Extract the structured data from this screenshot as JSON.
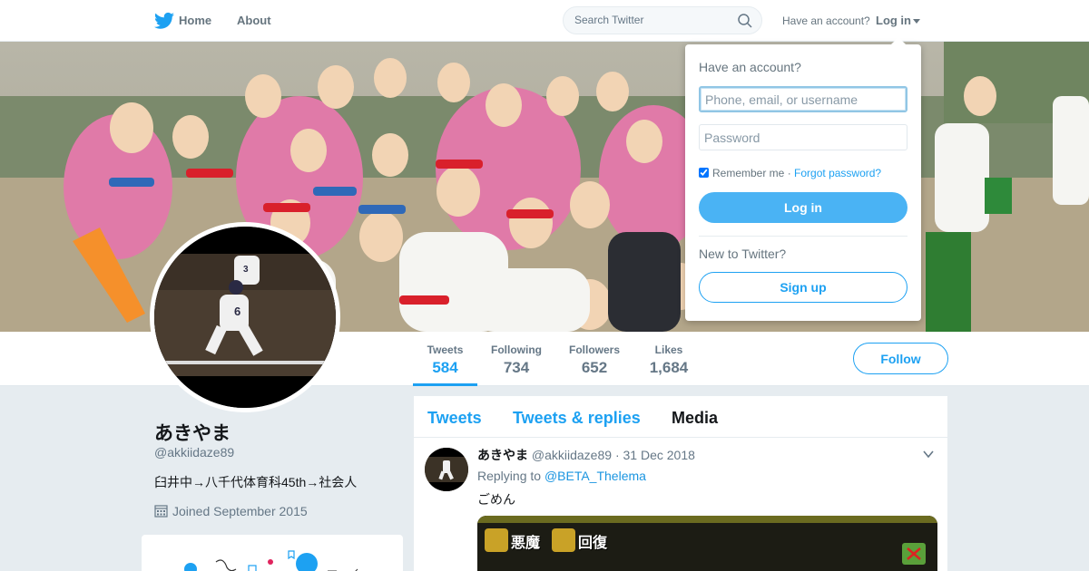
{
  "nav": {
    "home_label": "Home",
    "about_label": "About",
    "search_placeholder": "Search Twitter",
    "have_account": "Have an account?",
    "login_label": "Log in"
  },
  "profile": {
    "name": "あきやま",
    "handle": "@akkiidaze89",
    "bio": "臼井中→八千代体育科45th→社会人",
    "joined": "Joined September 2015",
    "follow_label": "Follow",
    "stats": [
      {
        "label": "Tweets",
        "value": "584",
        "active": true
      },
      {
        "label": "Following",
        "value": "734",
        "active": false
      },
      {
        "label": "Followers",
        "value": "652",
        "active": false
      },
      {
        "label": "Likes",
        "value": "1,684",
        "active": false
      }
    ]
  },
  "timeline": {
    "tabs": [
      {
        "label": "Tweets",
        "selected": false
      },
      {
        "label": "Tweets & replies",
        "selected": false
      },
      {
        "label": "Media",
        "selected": true
      }
    ],
    "tweet": {
      "name": "あきやま",
      "handle": "@akkiidaze89",
      "separator": "·",
      "date": "31 Dec 2018",
      "replying_prefix": "Replying to",
      "replying_to": "@BETA_Thelema",
      "text": "ごめん",
      "media_labels": [
        "悪魔",
        "回復"
      ]
    }
  },
  "login_dropdown": {
    "title": "Have an account?",
    "username_placeholder": "Phone, email, or username",
    "password_placeholder": "Password",
    "remember_label": "Remember me",
    "separator": "·",
    "forgot_label": "Forgot password?",
    "login_button": "Log in",
    "new_label": "New to Twitter?",
    "signup_button": "Sign up"
  },
  "colors": {
    "accent": "#1da1f2",
    "login_button_bg": "#4ab3f4",
    "page_bg": "#e6ecf0",
    "muted_text": "#657786"
  }
}
